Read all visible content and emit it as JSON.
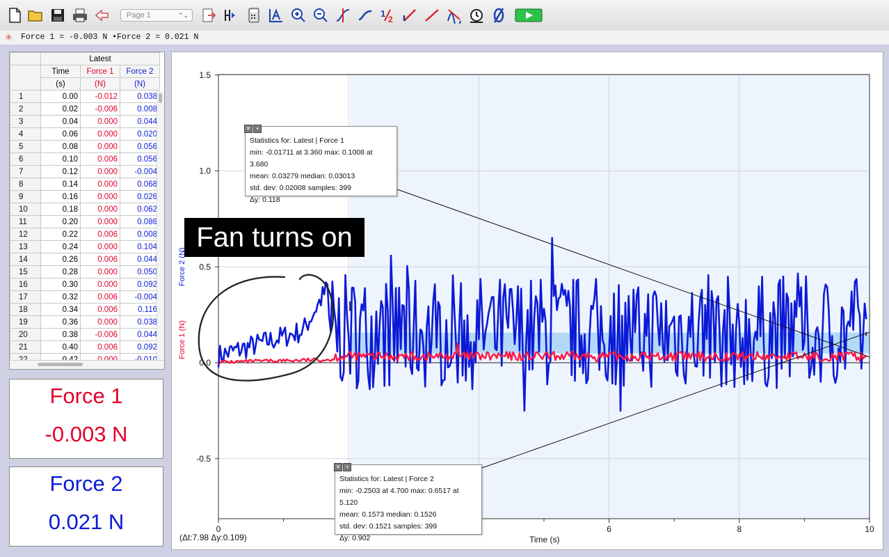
{
  "toolbar": {
    "page_select": "Page 1",
    "icons": [
      "new-file-icon",
      "open-folder-icon",
      "save-icon",
      "print-icon",
      "undo-icon",
      "next-page-icon",
      "data-browser-icon",
      "calculator-icon",
      "autoscale-icon",
      "zoom-in-icon",
      "zoom-out-icon",
      "examine-icon",
      "tangent-icon",
      "integral-icon",
      "statistics-icon",
      "linear-fit-icon",
      "curve-fit-icon",
      "timer-icon",
      "zero-icon",
      "collect-icon"
    ]
  },
  "status": {
    "text": "Force 1 = -0.003 N •Force 2 = 0.021 N"
  },
  "table": {
    "dataset": "Latest",
    "columns": [
      {
        "name": "Time",
        "unit": "(s)"
      },
      {
        "name": "Force 1",
        "unit": "(N)"
      },
      {
        "name": "Force 2",
        "unit": "(N)"
      }
    ],
    "rows": [
      [
        "1",
        "0.00",
        "-0.012",
        "0.038"
      ],
      [
        "2",
        "0.02",
        "-0.006",
        "0.008"
      ],
      [
        "3",
        "0.04",
        "0.000",
        "0.044"
      ],
      [
        "4",
        "0.06",
        "0.000",
        "0.020"
      ],
      [
        "5",
        "0.08",
        "0.000",
        "0.056"
      ],
      [
        "6",
        "0.10",
        "0.006",
        "0.056"
      ],
      [
        "7",
        "0.12",
        "0.000",
        "-0.004"
      ],
      [
        "8",
        "0.14",
        "0.000",
        "0.068"
      ],
      [
        "9",
        "0.16",
        "0.000",
        "0.026"
      ],
      [
        "10",
        "0.18",
        "0.000",
        "0.062"
      ],
      [
        "11",
        "0.20",
        "0.000",
        "0.086"
      ],
      [
        "12",
        "0.22",
        "0.006",
        "0.008"
      ],
      [
        "13",
        "0.24",
        "0.000",
        "0.104"
      ],
      [
        "14",
        "0.26",
        "0.006",
        "0.044"
      ],
      [
        "15",
        "0.28",
        "0.000",
        "0.050"
      ],
      [
        "16",
        "0.30",
        "0.000",
        "0.092"
      ],
      [
        "17",
        "0.32",
        "0.006",
        "-0.004"
      ],
      [
        "18",
        "0.34",
        "0.006",
        "0.116"
      ],
      [
        "19",
        "0.36",
        "0.000",
        "0.038"
      ],
      [
        "20",
        "0.38",
        "-0.006",
        "0.044"
      ],
      [
        "21",
        "0.40",
        "0.006",
        "0.092"
      ],
      [
        "22",
        "0.42",
        "0.000",
        "-0.010"
      ]
    ]
  },
  "meters": {
    "force1": {
      "label": "Force 1",
      "value": "-0.003 N"
    },
    "force2": {
      "label": "Force 2",
      "value": "0.021 N"
    }
  },
  "graph": {
    "annotation": "Fan turns on",
    "delta_readout": "(Δt:7.98 Δy:0.109)",
    "stats1": {
      "title": "Statistics for: Latest | Force 1",
      "line1": "min: -0.01711 at 3.360 max: 0.1008 at 3.680",
      "line2": "mean: 0.03279 median: 0.03013",
      "line3": "std. dev: 0.02008 samples: 399",
      "line4": "Δy: 0.118"
    },
    "stats2": {
      "title": "Statistics for: Latest | Force 2",
      "line1": "min: -0.2503 at 4.700 max: 0.6517 at 5.120",
      "line2": "mean: 0.1573 median: 0.1526",
      "line3": "std. dev: 0.1521 samples: 399",
      "line4": "Δy: 0.902"
    },
    "colors": {
      "force1": "#ff1744",
      "force2": "#0b1ad6",
      "selection": "#eef4fd",
      "mean_band": "#a9d3f7"
    }
  },
  "chart_data": {
    "type": "line",
    "xlabel": "Time (s)",
    "ylabel_series": [
      "Force 1 (N)",
      "Force 2 (N)"
    ],
    "xlim": [
      0,
      10
    ],
    "ylim": [
      -0.8,
      1.5
    ],
    "x_ticks": [
      "0",
      "2",
      "4",
      "6",
      "8",
      "10"
    ],
    "y_ticks": [
      "1.5",
      "1.0",
      "0.5",
      "0.0",
      "-0.5"
    ],
    "selection": [
      2.02,
      10
    ],
    "grid": true,
    "series": [
      {
        "name": "Force 1",
        "color": "#ff1744",
        "mean": 0.033
      },
      {
        "name": "Force 2",
        "color": "#0b1ad6",
        "mean": 0.157
      }
    ]
  }
}
